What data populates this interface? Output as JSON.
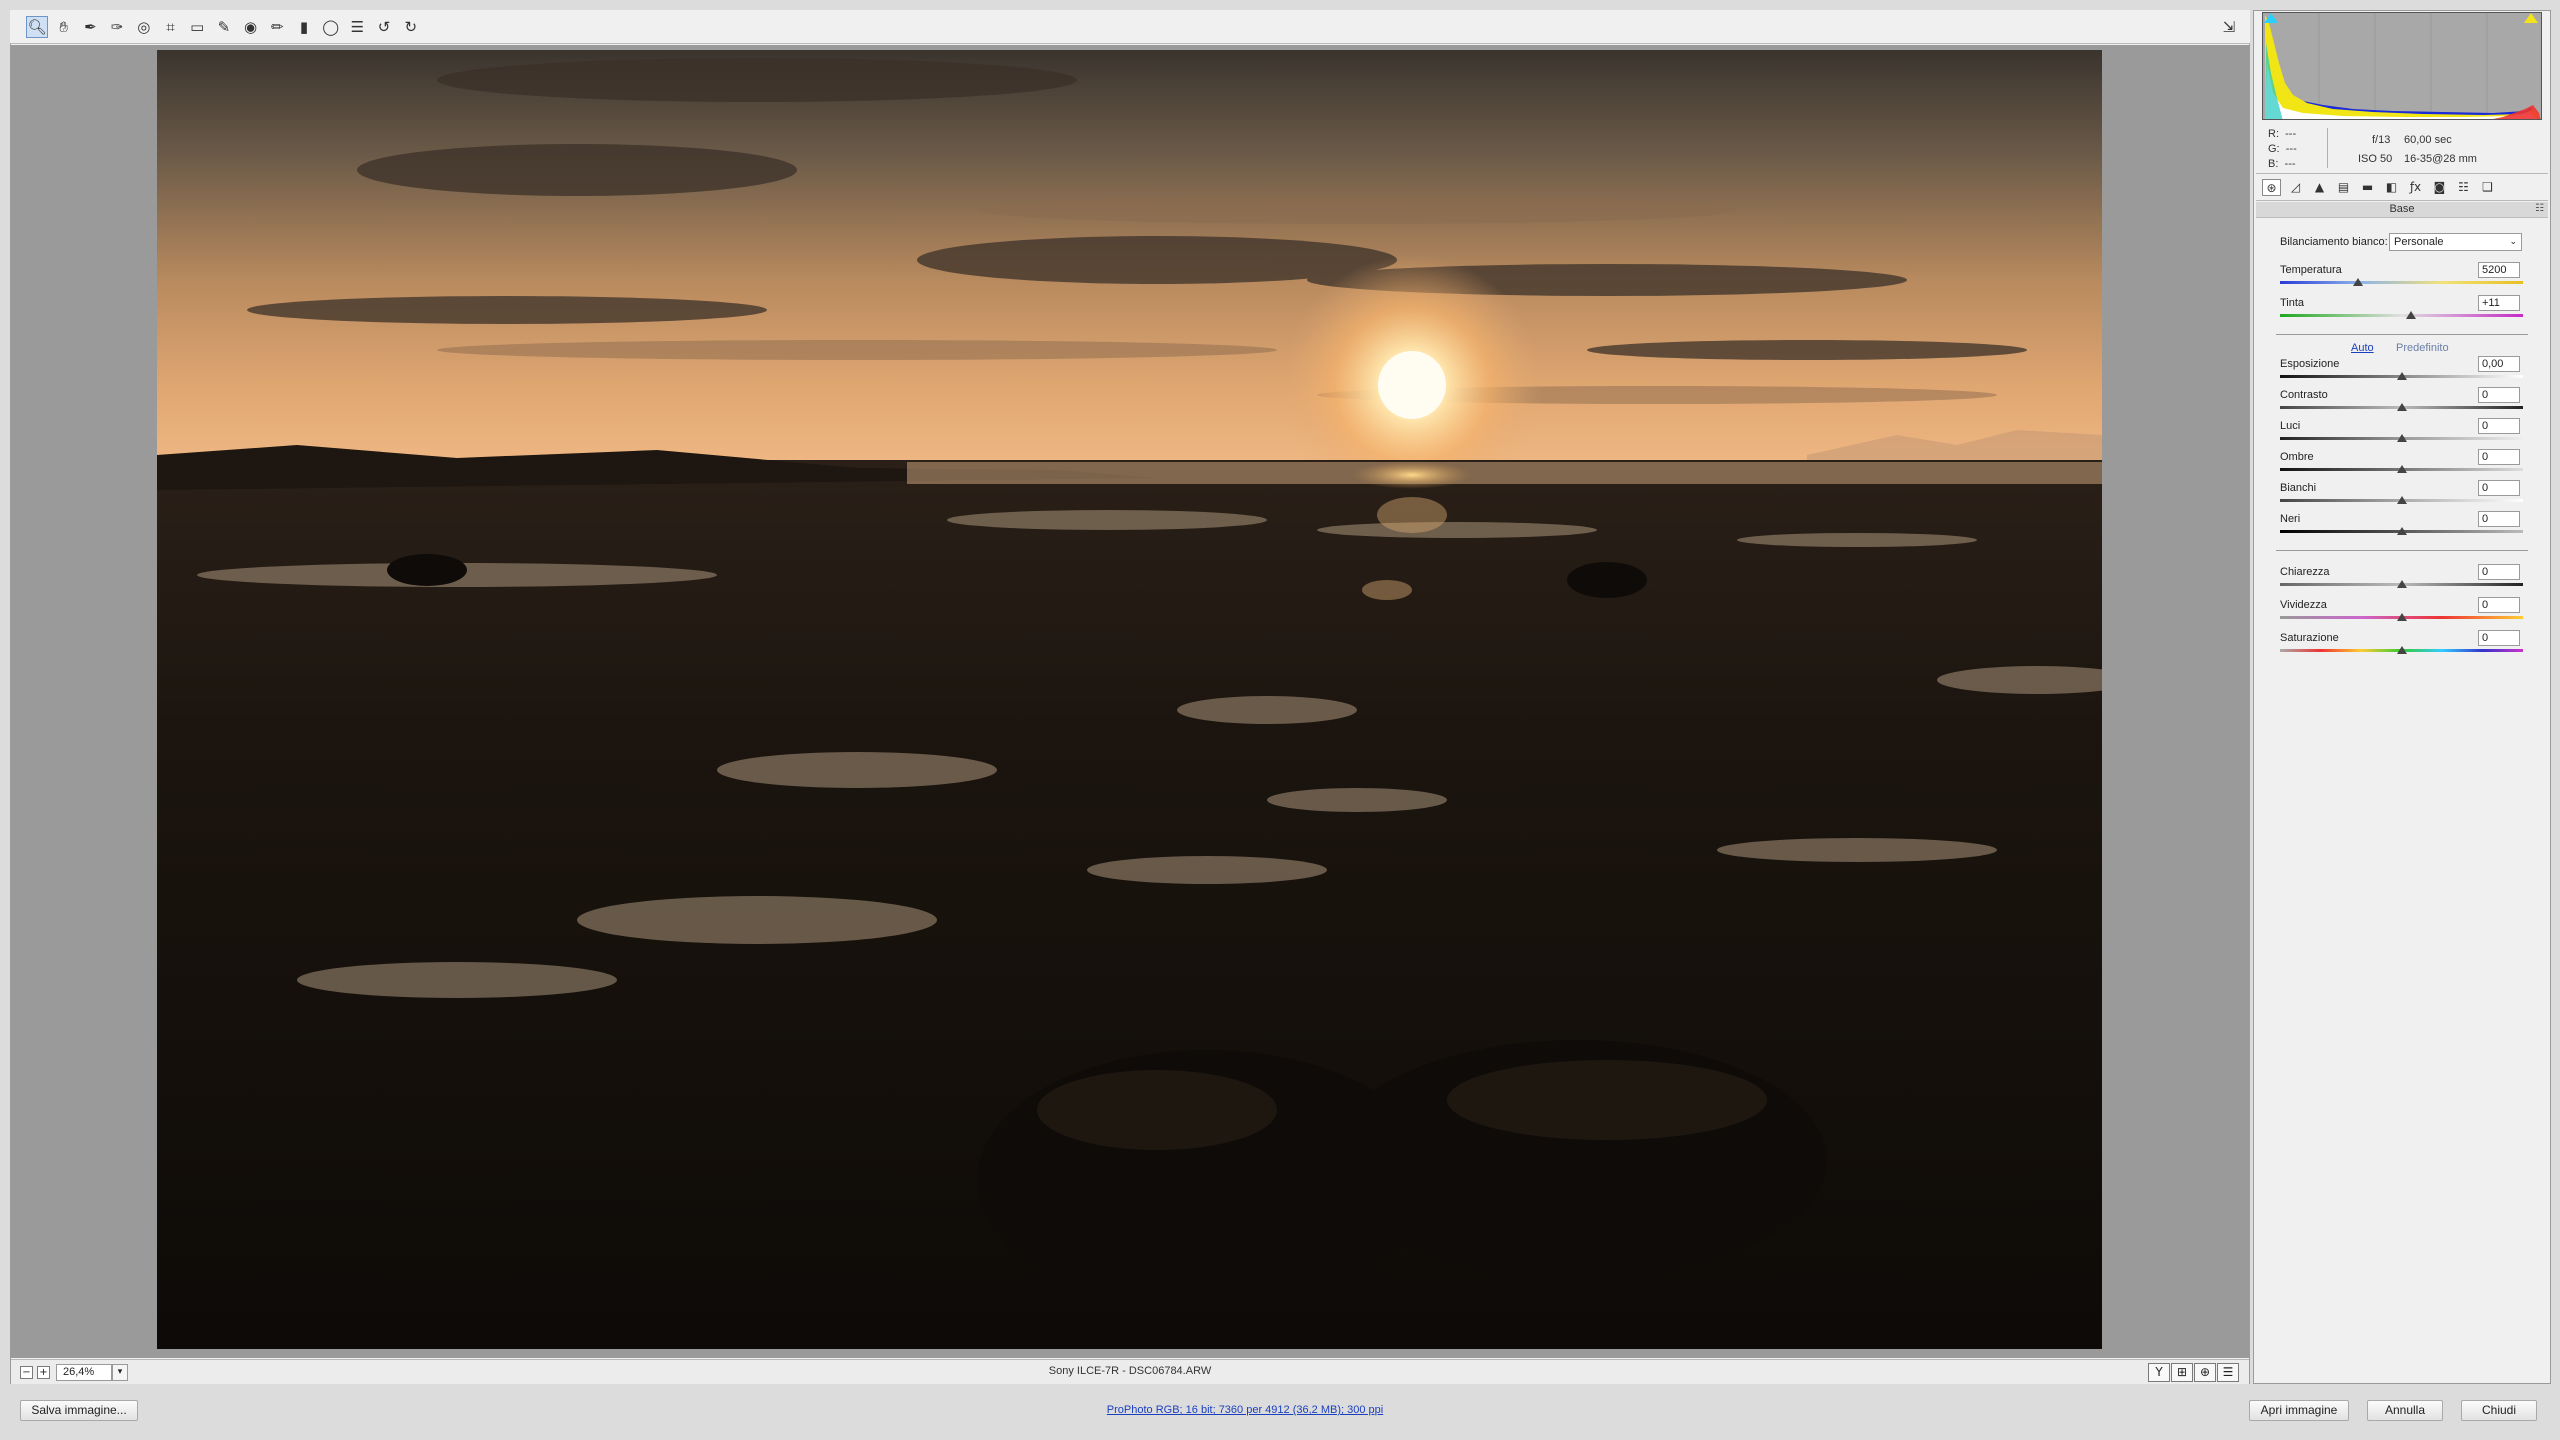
{
  "toolbar": {
    "tools": [
      {
        "name": "zoom-tool-icon",
        "glyph": "🔍︎",
        "active": true
      },
      {
        "name": "hand-tool-icon",
        "glyph": "✋︎",
        "active": false
      },
      {
        "name": "white-balance-tool-icon",
        "glyph": "✒",
        "active": false
      },
      {
        "name": "color-sampler-tool-icon",
        "glyph": "✑",
        "active": false
      },
      {
        "name": "targeted-adjustment-tool-icon",
        "glyph": "◎",
        "active": false
      },
      {
        "name": "crop-tool-icon",
        "glyph": "⌗",
        "active": false
      },
      {
        "name": "straighten-tool-icon",
        "glyph": "▭",
        "active": false
      },
      {
        "name": "spot-removal-tool-icon",
        "glyph": "✎",
        "active": false
      },
      {
        "name": "red-eye-tool-icon",
        "glyph": "◉",
        "active": false
      },
      {
        "name": "adjustment-brush-icon",
        "glyph": "✏",
        "active": false
      },
      {
        "name": "graduated-filter-icon",
        "glyph": "▮",
        "active": false
      },
      {
        "name": "radial-filter-icon",
        "glyph": "◯",
        "active": false
      },
      {
        "name": "preferences-icon",
        "glyph": "☰",
        "active": false
      },
      {
        "name": "rotate-left-icon",
        "glyph": "↺",
        "active": false
      },
      {
        "name": "rotate-right-icon",
        "glyph": "↻",
        "active": false
      }
    ],
    "fullscreen_icon": "⇲"
  },
  "preview": {
    "zoom_minus": "−",
    "zoom_plus": "+",
    "zoom_value": "26,4%",
    "zoom_chevron": "▾",
    "file_label": "Sony ILCE-7R  -  DSC06784.ARW",
    "view_buttons": [
      "Y",
      "⊞",
      "⊕",
      "☰"
    ]
  },
  "histogram": {
    "rgb": [
      {
        "label": "R:",
        "value": "---"
      },
      {
        "label": "G:",
        "value": "---"
      },
      {
        "label": "B:",
        "value": "---"
      }
    ],
    "aperture": "f/13",
    "shutter": "60,00 sec",
    "iso": "ISO 50",
    "lens": "16-35@28 mm"
  },
  "panel": {
    "tabs": [
      "⊛",
      "◿",
      "▲",
      "▤",
      "▬",
      "◧",
      "ƒx",
      "◙",
      "☷",
      "❑"
    ],
    "section_title": "Base",
    "section_menu": "☷",
    "white_balance_label": "Bilanciamento bianco:",
    "white_balance_value": "Personale",
    "chevron": "⌄",
    "auto_link": "Auto",
    "default_link": "Predefinito",
    "sliders": {
      "temperatura": {
        "label": "Temperatura",
        "value": "5200",
        "level": 0.32
      },
      "tinta": {
        "label": "Tinta",
        "value": "+11",
        "level": 0.54
      },
      "esposizione": {
        "label": "Esposizione",
        "value": "0,00",
        "level": 0.5
      },
      "contrasto": {
        "label": "Contrasto",
        "value": "0",
        "level": 0.5
      },
      "luci": {
        "label": "Luci",
        "value": "0",
        "level": 0.5
      },
      "ombre": {
        "label": "Ombre",
        "value": "0",
        "level": 0.5
      },
      "bianchi": {
        "label": "Bianchi",
        "value": "0",
        "level": 0.5
      },
      "neri": {
        "label": "Neri",
        "value": "0",
        "level": 0.5
      },
      "chiarezza": {
        "label": "Chiarezza",
        "value": "0",
        "level": 0.5
      },
      "vividezza": {
        "label": "Vividezza",
        "value": "0",
        "level": 0.5
      },
      "saturazione": {
        "label": "Saturazione",
        "value": "0",
        "level": 0.5
      }
    }
  },
  "bottom": {
    "save_label": "Salva immagine...",
    "workflow_link": "ProPhoto RGB; 16 bit; 7360 per 4912 (36,2 MB); 300 ppi",
    "open_label": "Apri immagine",
    "cancel_label": "Annulla",
    "close_label": "Chiudi"
  },
  "colors": {
    "accent": "#1a3fbf",
    "panel_bg": "#f0f0f0",
    "preview_bg": "#9a9a9a"
  }
}
